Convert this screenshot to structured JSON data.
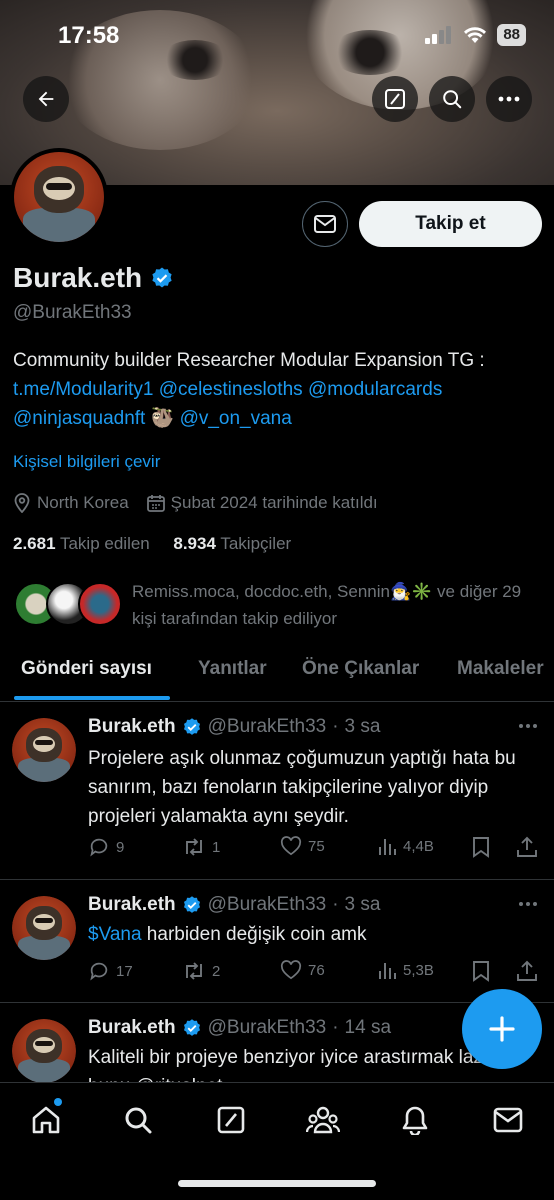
{
  "status_bar": {
    "time": "17:58",
    "battery": "88"
  },
  "profile": {
    "display_name": "Burak.eth",
    "handle": "@BurakEth33",
    "follow_label": "Takip et",
    "bio_text": "Community builder Researcher Modular Expansion TG :",
    "bio_links": [
      "t.me/Modularity1",
      "@celestinesloths",
      "@modularcards",
      "@ninjasquadnft",
      "@v_on_vana"
    ],
    "bio_emoji": "🦥",
    "translate_label": "Kişisel bilgileri çevir",
    "location": "North Korea",
    "joined": "Şubat 2024 tarihinde katıldı",
    "following_count": "2.681",
    "following_label": "Takip edilen",
    "followers_count": "8.934",
    "followers_label": "Takipçiler",
    "followed_by_text": "Remiss.moca, docdoc.eth, Sennin🧙‍♂️✳️ ve diğer 29 kişi tarafından takip ediliyor"
  },
  "tabs": [
    "Gönderi sayısı",
    "Yanıtlar",
    "Öne Çıkanlar",
    "Makaleler"
  ],
  "tweets": [
    {
      "name": "Burak.eth",
      "handle": "@BurakEth33",
      "time": "3 sa",
      "text": "Projelere aşık olunmaz çoğumuzun yaptığı hata bu sanırım, bazı fenoların takipçilerine yalıyor diyip projeleri yalamakta aynı şeydir.",
      "replies": "9",
      "reposts": "1",
      "likes": "75",
      "views": "4,4B"
    },
    {
      "name": "Burak.eth",
      "handle": "@BurakEth33",
      "time": "3 sa",
      "cashtag": "$Vana",
      "text": " harbiden değişik coin amk",
      "replies": "17",
      "reposts": "2",
      "likes": "76",
      "views": "5,3B"
    },
    {
      "name": "Burak.eth",
      "handle": "@BurakEth33",
      "time": "14 sa",
      "text": "Kaliteli bir projeye benziyor iyice arastırmak lazım bunu @ritualnet"
    }
  ],
  "colors": {
    "accent": "#1d9bf0",
    "background": "#000000",
    "muted": "#71767b"
  }
}
